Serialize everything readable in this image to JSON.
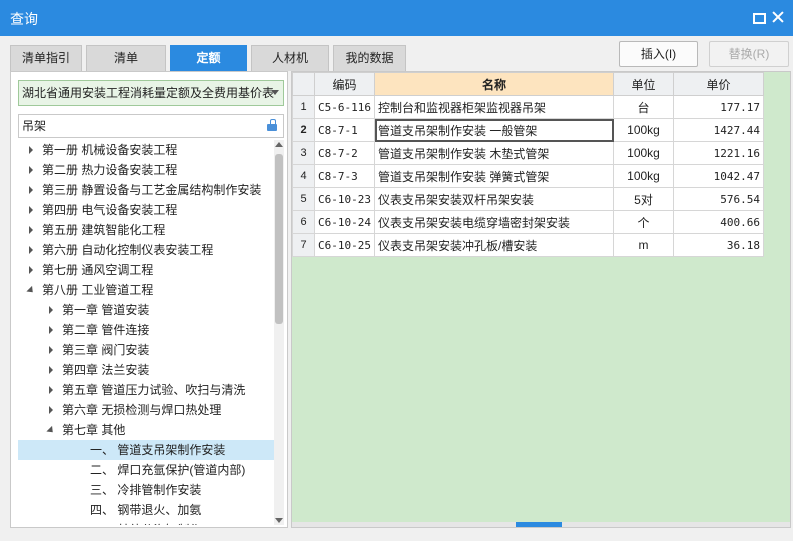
{
  "window": {
    "title": "查询"
  },
  "tabs": [
    {
      "label": "清单指引"
    },
    {
      "label": "清单"
    },
    {
      "label": "定额",
      "active": true
    },
    {
      "label": "人材机"
    },
    {
      "label": "我的数据"
    }
  ],
  "buttons": {
    "insert": "插入(I)",
    "replace": "替换(R)"
  },
  "library": {
    "selected": "湖北省通用安装工程消耗量定额及全费用基价表"
  },
  "search": {
    "value": "吊架"
  },
  "tree": [
    {
      "label": "第一册  机械设备安装工程",
      "level": 0,
      "state": "collapsed"
    },
    {
      "label": "第二册  热力设备安装工程",
      "level": 0,
      "state": "collapsed"
    },
    {
      "label": "第三册  静置设备与工艺金属结构制作安装",
      "level": 0,
      "state": "collapsed"
    },
    {
      "label": "第四册  电气设备安装工程",
      "level": 0,
      "state": "collapsed"
    },
    {
      "label": "第五册  建筑智能化工程",
      "level": 0,
      "state": "collapsed"
    },
    {
      "label": "第六册  自动化控制仪表安装工程",
      "level": 0,
      "state": "collapsed"
    },
    {
      "label": "第七册  通风空调工程",
      "level": 0,
      "state": "collapsed"
    },
    {
      "label": "第八册  工业管道工程",
      "level": 0,
      "state": "expanded"
    },
    {
      "label": "第一章  管道安装",
      "level": 1,
      "state": "collapsed"
    },
    {
      "label": "第二章  管件连接",
      "level": 1,
      "state": "collapsed"
    },
    {
      "label": "第三章  阀门安装",
      "level": 1,
      "state": "collapsed"
    },
    {
      "label": "第四章  法兰安装",
      "level": 1,
      "state": "collapsed"
    },
    {
      "label": "第五章  管道压力试验、吹扫与清洗",
      "level": 1,
      "state": "collapsed"
    },
    {
      "label": "第六章  无损检测与焊口热处理",
      "level": 1,
      "state": "collapsed"
    },
    {
      "label": "第七章  其他",
      "level": 1,
      "state": "expanded"
    },
    {
      "label": "一、  管道支吊架制作安装",
      "level": 2,
      "state": "leaf",
      "selected": true
    },
    {
      "label": "二、  焊口充氩保护(管道内部)",
      "level": 2,
      "state": "leaf"
    },
    {
      "label": "三、  冷排管制作安装",
      "level": 2,
      "state": "leaf"
    },
    {
      "label": "四、  钢带退火、加氨",
      "level": 2,
      "state": "leaf"
    },
    {
      "label": "五、  其他分汽缸制作",
      "level": 2,
      "state": "leaf"
    }
  ],
  "grid": {
    "columns": [
      "编码",
      "名称",
      "单位",
      "单价"
    ],
    "rows": [
      {
        "num": "1",
        "code": "C5-6-116",
        "name": "控制台和监视器柜架监视器吊架",
        "unit": "台",
        "price": "177.17"
      },
      {
        "num": "2",
        "code": "C8-7-1",
        "name": "管道支吊架制作安装 一般管架",
        "unit": "100kg",
        "price": "1427.44"
      },
      {
        "num": "3",
        "code": "C8-7-2",
        "name": "管道支吊架制作安装 木垫式管架",
        "unit": "100kg",
        "price": "1221.16"
      },
      {
        "num": "4",
        "code": "C8-7-3",
        "name": "管道支吊架制作安装 弹簧式管架",
        "unit": "100kg",
        "price": "1042.47"
      },
      {
        "num": "5",
        "code": "C6-10-23",
        "name": "仪表支吊架安装双杆吊架安装",
        "unit": "5对",
        "price": "576.54"
      },
      {
        "num": "6",
        "code": "C6-10-24",
        "name": "仪表支吊架安装电缆穿墙密封架安装",
        "unit": "个",
        "price": "400.66"
      },
      {
        "num": "7",
        "code": "C6-10-25",
        "name": "仪表支吊架安装冲孔板/槽安装",
        "unit": "m",
        "price": "36.18"
      }
    ]
  },
  "colors": {
    "accent": "#2b8ae0",
    "grid_bg": "#cfe9cc",
    "selected_bg": "#cde8f8",
    "name_header_bg": "#fde4bf"
  }
}
